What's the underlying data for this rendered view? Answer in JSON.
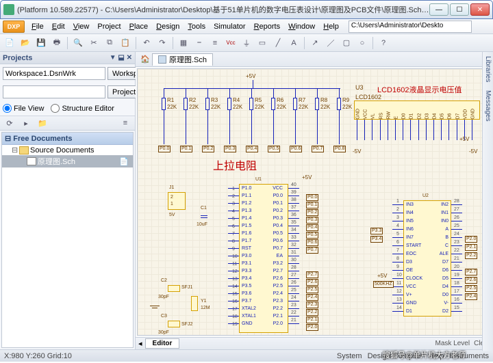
{
  "window": {
    "title": "(Platform 10.589.22577) - C:\\Users\\Administrator\\Desktop\\基于51单片机的数字电压表设计\\原理图及PCB文件\\原理图.Sch - Free Documen...",
    "dxp": "DXP",
    "path_display": "C:\\Users\\Administrator\\Deskto"
  },
  "menu": {
    "file": "File",
    "edit": "Edit",
    "view": "View",
    "project": "Project",
    "place": "Place",
    "design": "Design",
    "tools": "Tools",
    "simulator": "Simulator",
    "reports": "Reports",
    "window": "Window",
    "help": "Help"
  },
  "projects": {
    "title": "Projects",
    "workspace_value": "Workspace1.DsnWrk",
    "workspace_btn": "Workspace",
    "project_value": "",
    "project_btn": "Project",
    "opt_file": "File View",
    "opt_struct": "Structure Editor",
    "tree_root": "Free Documents",
    "tree_src": "Source Documents",
    "tree_doc": "原理图.Sch"
  },
  "tab": {
    "name": "原理图.Sch",
    "editor": "Editor"
  },
  "schematic": {
    "pull_up": "上拉电阻",
    "lcd_title": "LCD1602液晶显示电压值",
    "lcd_ref": "LCD1602",
    "u3": "U3",
    "u1": "U1",
    "u2": "U2",
    "j1": "J1",
    "j1_val": "5V",
    "c1": "C1",
    "c1_val": "10uF",
    "c2": "C2",
    "c2_val": "30pF",
    "c3": "C3",
    "c3_val": "30pF",
    "y1": "Y1",
    "y1_val": "12M",
    "sfj1": "SFJ1",
    "sfj2": "SFJ2",
    "p5v": "+5V",
    "n5v": "-5V",
    "clk": "500KHZ",
    "resistors": [
      {
        "ref": "R1",
        "val": "22K"
      },
      {
        "ref": "R2",
        "val": "22K"
      },
      {
        "ref": "R3",
        "val": "22K"
      },
      {
        "ref": "R4",
        "val": "22K"
      },
      {
        "ref": "R5",
        "val": "22K"
      },
      {
        "ref": "R6",
        "val": "22K"
      },
      {
        "ref": "R7",
        "val": "22K"
      },
      {
        "ref": "R8",
        "val": "22K"
      },
      {
        "ref": "R9",
        "val": "22K"
      }
    ],
    "lcd_pins": [
      "GND",
      "VCC",
      "VL",
      "RS",
      "RW",
      "E",
      "D0",
      "D1",
      "D2",
      "D3",
      "D4",
      "D5",
      "D6",
      "D7",
      "VDD",
      "GND"
    ],
    "u1_left": [
      "P1.0",
      "P1.1",
      "P1.2",
      "P1.3",
      "P1.4",
      "P1.5",
      "P1.6",
      "P1.7",
      "RST",
      "P3.0",
      "P3.1",
      "P3.3",
      "P3.4",
      "P3.5",
      "P3.6",
      "P3.7",
      "XTAL2",
      "XTAL1",
      "GND"
    ],
    "u1_right": [
      "VCC",
      "P0.0",
      "P0.1",
      "P0.2",
      "P0.3",
      "P0.4",
      "P0.5",
      "P0.6",
      "P0.7",
      "EA",
      "P3.2",
      "P2.7",
      "P2.6",
      "P2.5",
      "P2.4",
      "P2.3",
      "P2.2",
      "P2.1",
      "P2.0"
    ],
    "u1_rnum": [
      "40",
      "39",
      "38",
      "37",
      "36",
      "35",
      "34",
      "33",
      "32",
      "31",
      "30",
      "28",
      "27",
      "26",
      "25",
      "24",
      "23",
      "22",
      "21"
    ],
    "u2_left": [
      "IN3",
      "IN4",
      "IN5",
      "IN6",
      "IN7",
      "START",
      "EOC",
      "D3",
      "OE",
      "CLOCK",
      "VCC",
      "V+",
      "GND",
      "D1"
    ],
    "u2_right": [
      "IN2",
      "IN1",
      "IN0",
      "A",
      "B",
      "C",
      "ALE",
      "D7",
      "D6",
      "D5",
      "D4",
      "D0",
      "V-",
      "D2"
    ],
    "u2_lnum": [
      "1",
      "2",
      "3",
      "4",
      "5",
      "6",
      "7",
      "8",
      "9",
      "10",
      "11",
      "12",
      "13",
      "14"
    ],
    "u2_rnum": [
      "28",
      "27",
      "26",
      "25",
      "24",
      "23",
      "22",
      "21",
      "20",
      "19",
      "18",
      "17",
      "16",
      "15"
    ],
    "nets_mid": [
      "P0.0",
      "P0.1",
      "P0.2",
      "P0.3",
      "P0.4",
      "P0.5",
      "P0.6",
      "P0.7"
    ],
    "nets_p2": [
      "P2.7",
      "P2.6",
      "P2.5",
      "P2.4",
      "P2.3",
      "P2.2",
      "P2.1",
      "P2.0"
    ],
    "nets_p3": [
      "P3.3",
      "P3.4"
    ],
    "nets_u2": [
      "P3.3",
      "P3.4",
      "",
      "",
      "P2.0",
      "P2.1",
      "P2.2",
      "",
      "P2.7",
      "P2.6",
      "P2.5",
      "P2.4",
      ""
    ]
  },
  "status": {
    "coords": "X:980 Y:260  Grid:10",
    "system": "System",
    "design": "Design Compiler",
    "help": "Help",
    "instr": "Instruments",
    "mask": "Mask Level",
    "clear": "Clear"
  },
  "rails": {
    "lib": "Libraries",
    "msg": "Messages"
  },
  "watermark": "搜狐号@单片机大方老师"
}
